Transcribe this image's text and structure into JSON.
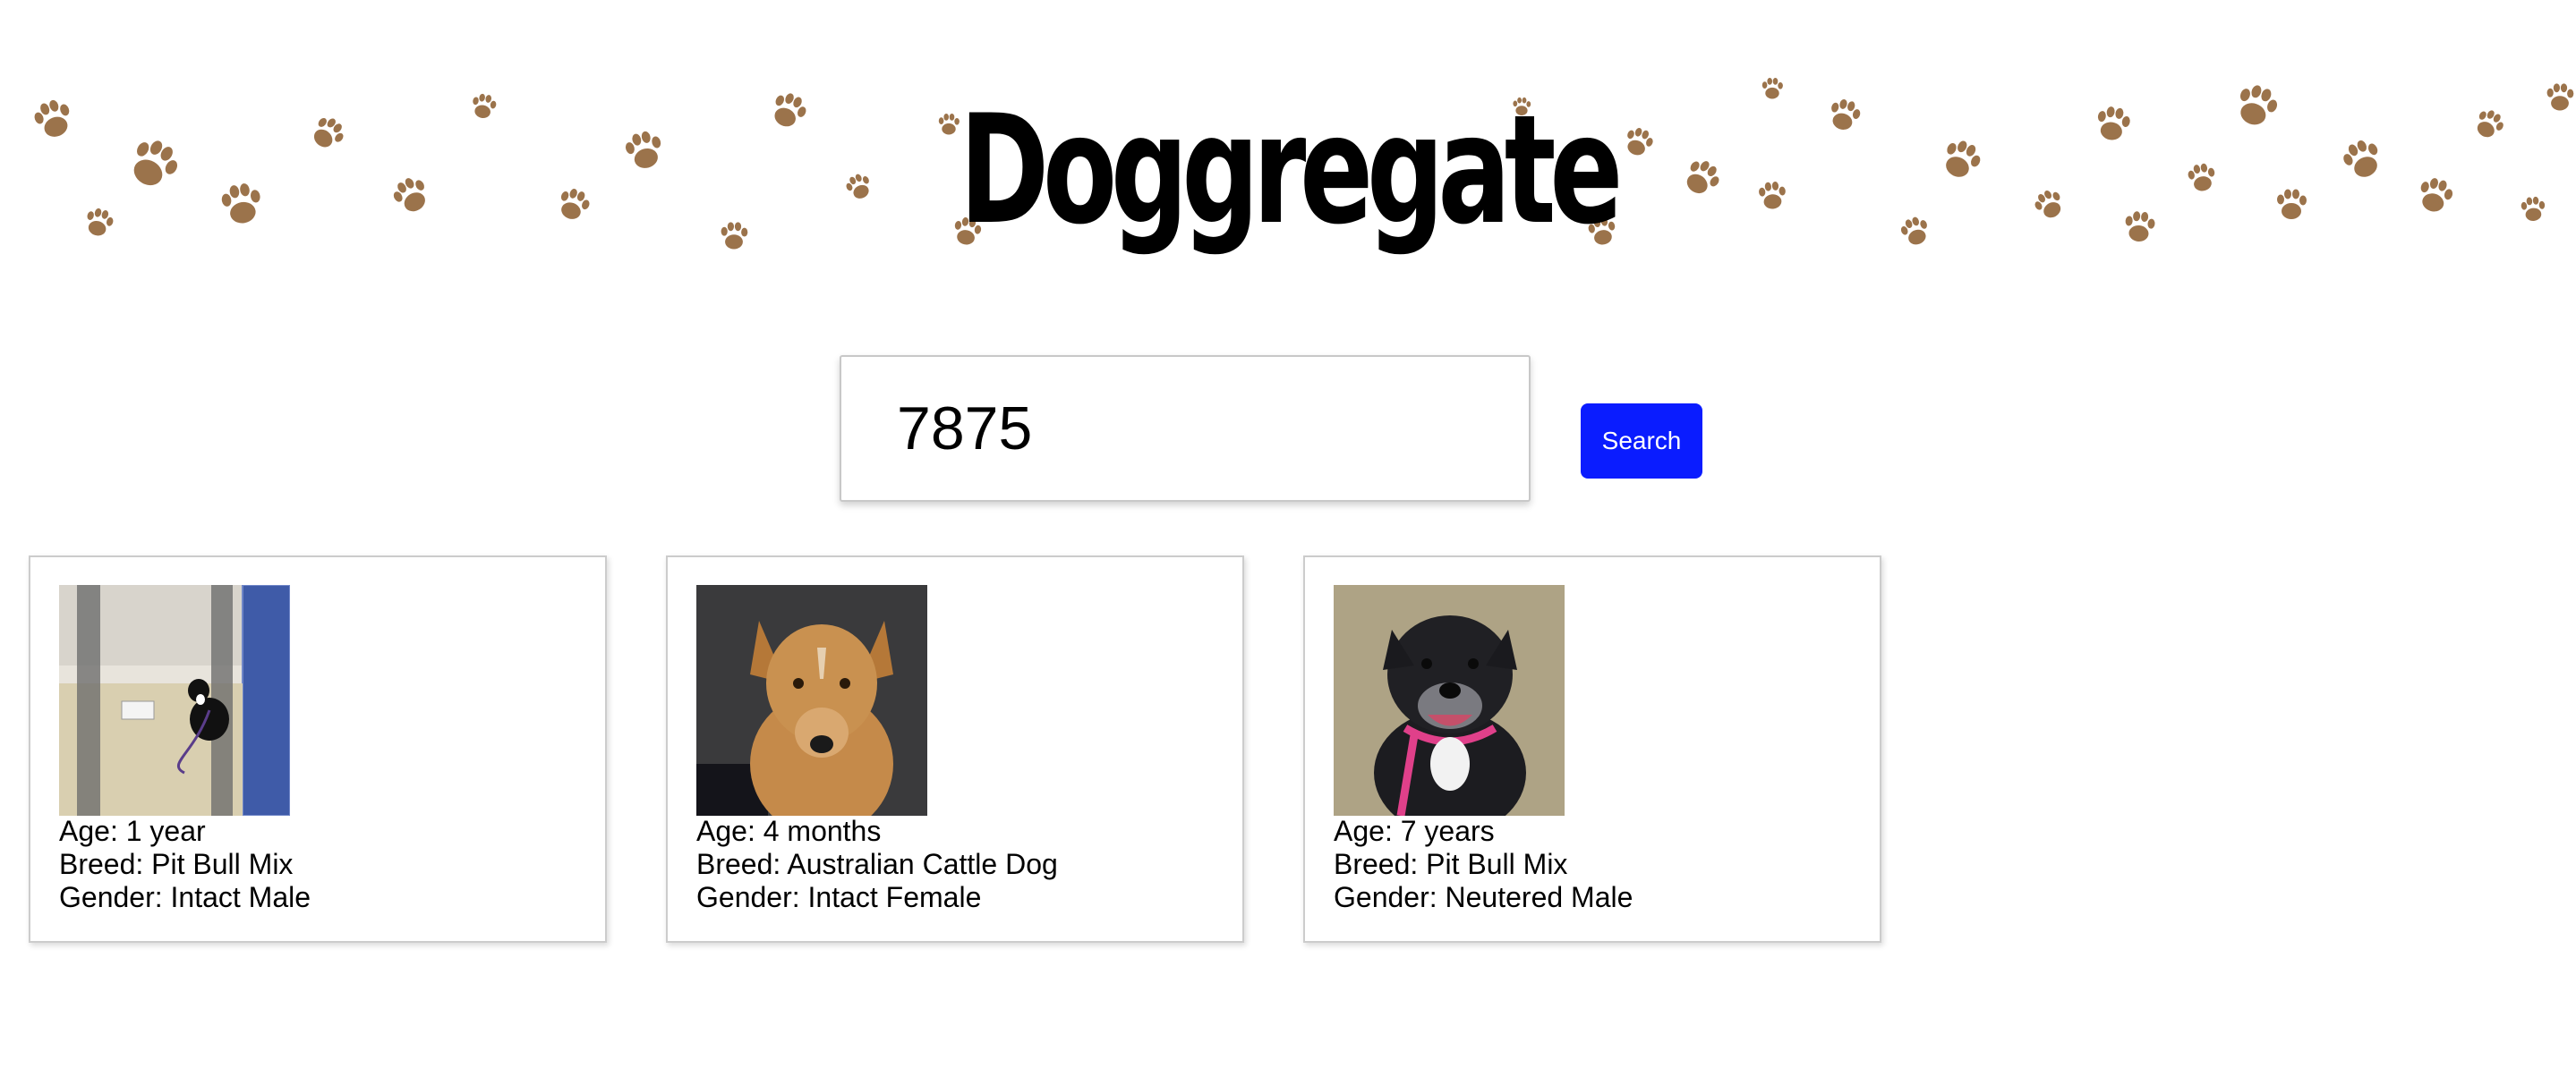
{
  "header": {
    "title": "Doggregate",
    "background_pattern": "paw-prints"
  },
  "search": {
    "value": "7875",
    "button_label": "Search"
  },
  "colors": {
    "button": "#0a1cff",
    "paw": "#8a5a2b"
  },
  "results": [
    {
      "photo_icon": "dog-photo-kennel",
      "age": "Age: 1 year",
      "breed": "Breed: Pit Bull Mix",
      "gender": "Gender: Intact Male"
    },
    {
      "photo_icon": "dog-photo-tan",
      "age": "Age: 4 months",
      "breed": "Breed: Australian Cattle Dog",
      "gender": "Gender: Intact Female"
    },
    {
      "photo_icon": "dog-photo-black",
      "age": "Age: 7 years",
      "breed": "Breed: Pit Bull Mix",
      "gender": "Gender: Neutered Male"
    }
  ]
}
